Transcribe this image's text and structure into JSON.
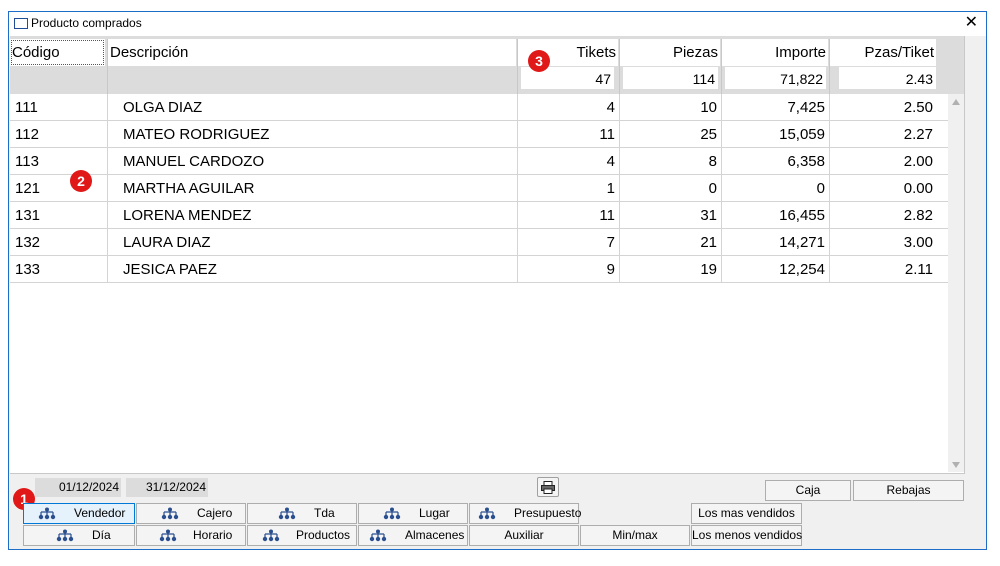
{
  "window": {
    "title": "Producto comprados",
    "close_glyph": "✕"
  },
  "columns": {
    "code": "Código",
    "description": "Descripción",
    "tickets": "Tikets",
    "pieces": "Piezas",
    "amount": "Importe",
    "pcs_per_ticket": "Pzas/Tiket"
  },
  "totals": {
    "tickets": "47",
    "pieces": "114",
    "amount": "71,822",
    "pcs_per_ticket": "2.43"
  },
  "rows": [
    {
      "code": "111",
      "description": "OLGA DIAZ",
      "tickets": "4",
      "pieces": "10",
      "amount": "7,425",
      "pcs_per_ticket": "2.50"
    },
    {
      "code": "112",
      "description": "MATEO RODRIGUEZ",
      "tickets": "11",
      "pieces": "25",
      "amount": "15,059",
      "pcs_per_ticket": "2.27"
    },
    {
      "code": "113",
      "description": "MANUEL CARDOZO",
      "tickets": "4",
      "pieces": "8",
      "amount": "6,358",
      "pcs_per_ticket": "2.00"
    },
    {
      "code": "121",
      "description": "MARTHA AGUILAR",
      "tickets": "1",
      "pieces": "0",
      "amount": "0",
      "pcs_per_ticket": "0.00"
    },
    {
      "code": "131",
      "description": "LORENA MENDEZ",
      "tickets": "11",
      "pieces": "31",
      "amount": "16,455",
      "pcs_per_ticket": "2.82"
    },
    {
      "code": "132",
      "description": "LAURA DIAZ",
      "tickets": "7",
      "pieces": "21",
      "amount": "14,271",
      "pcs_per_ticket": "3.00"
    },
    {
      "code": "133",
      "description": "JESICA PAEZ",
      "tickets": "9",
      "pieces": "19",
      "amount": "12,254",
      "pcs_per_ticket": "2.11"
    }
  ],
  "dates": {
    "from": "01/12/2024",
    "to": "31/12/2024"
  },
  "badges": {
    "one": "1",
    "two": "2",
    "three": "3"
  },
  "icons": {
    "printer": "printer-icon",
    "tree": "tree-icon"
  },
  "buttons": {
    "vendedor": "Vendedor",
    "cajero": "Cajero",
    "tda": "Tda",
    "lugar": "Lugar",
    "presupuesto": "Presupuesto",
    "mas_vendidos": "Los mas vendidos",
    "dia": "Día",
    "horario": "Horario",
    "productos": "Productos",
    "almacenes": "Almacenes",
    "auxiliar": "Auxiliar",
    "minmax": "Min/max",
    "menos_vendidos": "Los menos vendidos",
    "caja": "Caja",
    "rebajas": "Rebajas"
  },
  "colors": {
    "border_accent": "#1e6ec8",
    "badge": "#e01818",
    "icon": "#2a4f8f",
    "active_button": "#e5f1fb"
  }
}
